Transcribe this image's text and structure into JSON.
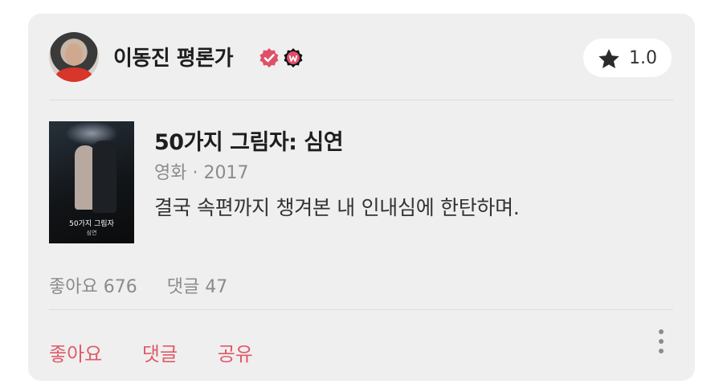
{
  "user": {
    "name": "이동진 평론가"
  },
  "rating": {
    "value": "1.0"
  },
  "movie": {
    "title": "50가지 그림자: 심연",
    "meta": "영화 · 2017",
    "poster_title": "50가지 그림자",
    "poster_sub": "심연"
  },
  "review": {
    "text": "결국 속편까지 챙겨본 내 인내심에 한탄하며."
  },
  "stats": {
    "likes": "좋아요 676",
    "comments": "댓글 47"
  },
  "actions": {
    "like": "좋아요",
    "comment": "댓글",
    "share": "공유"
  },
  "icons": {
    "verified": "verified-check-icon",
    "badge": "watcha-w-badge-icon",
    "star": "star-icon",
    "more": "more-vertical-icon"
  },
  "colors": {
    "accent": "#e05a6a",
    "verified": "#e04f68",
    "card": "#efefef"
  }
}
